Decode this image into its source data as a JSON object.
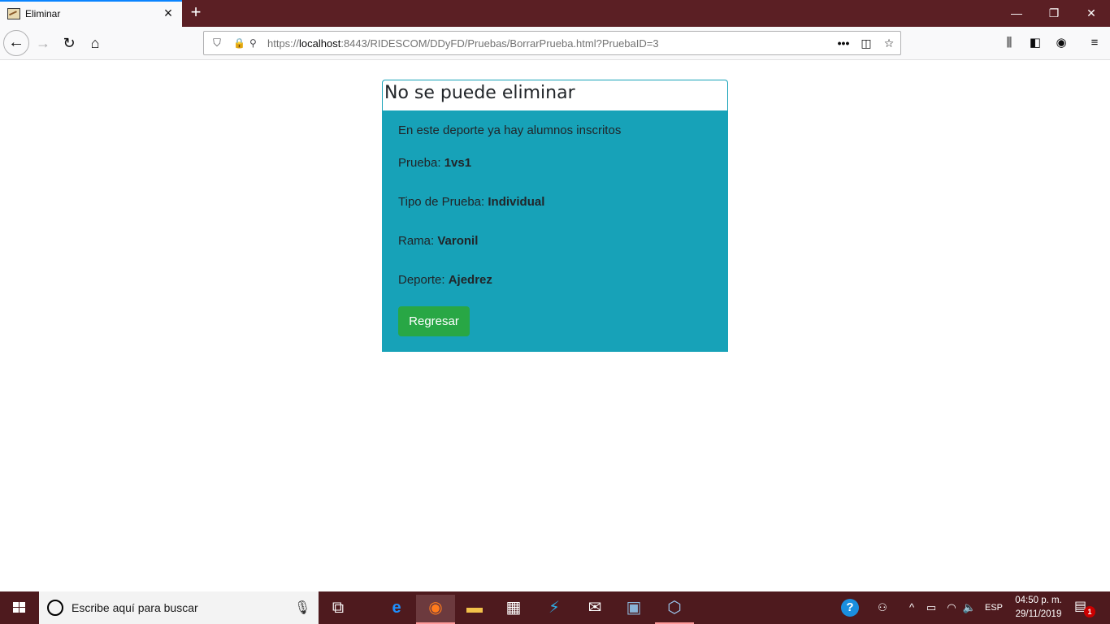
{
  "browser": {
    "tab_title": "Eliminar",
    "url_prefix": "https://",
    "url_host": "localhost",
    "url_rest": ":8443/RIDESCOM/DDyFD/Pruebas/BorrarPrueba.html?PruebaID=3",
    "icons": {
      "close": "×",
      "new_tab": "+",
      "minimize": "—",
      "maximize": "❐",
      "window_close": "✕",
      "back": "←",
      "forward": "→",
      "reload": "↻",
      "home": "⌂",
      "shield": "⛉",
      "lock": "🔒",
      "permissions": "⚲",
      "more": "•••",
      "pocket": "◫",
      "bookmark": "☆",
      "library": "⫼",
      "sidebar": "◧",
      "account": "◉",
      "menu": "≡"
    },
    "tab_accent_color": "#0a84ff",
    "titlebar_color": "#5b1f24"
  },
  "page": {
    "heading": "No se puede eliminar",
    "message": "En este deporte ya hay alumnos inscritos",
    "fields": [
      {
        "label": "Prueba: ",
        "value": "1vs1"
      },
      {
        "label": "Tipo de Prueba: ",
        "value": "Individual"
      },
      {
        "label": "Rama: ",
        "value": "Varonil"
      },
      {
        "label": "Deporte: ",
        "value": "Ajedrez"
      }
    ],
    "back_button": "Regresar",
    "card_color": "#17a2b8",
    "button_color": "#28a745"
  },
  "taskbar": {
    "search_placeholder": "Escribe aquí para buscar",
    "language": "ESP",
    "time": "04:50 p. m.",
    "date": "29/11/2019",
    "notification_count": "1",
    "help_glyph": "?",
    "apps": [
      "task-view",
      "edge",
      "firefox",
      "file-explorer",
      "store",
      "visual-studio",
      "mail",
      "sql-server",
      "virtualbox"
    ],
    "color": "#4e1a1e"
  }
}
